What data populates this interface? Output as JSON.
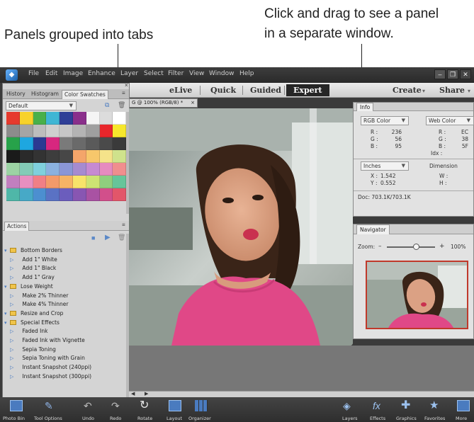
{
  "callouts": {
    "left": "Panels grouped into tabs",
    "right_line1": "Click and drag to see a panel",
    "right_line2": "in a separate window."
  },
  "menubar": {
    "items": [
      "File",
      "Edit",
      "Image",
      "Enhance",
      "Layer",
      "Select",
      "Filter",
      "View",
      "Window",
      "Help"
    ]
  },
  "modes": {
    "items": [
      "eLive",
      "Quick",
      "Guided",
      "Expert"
    ],
    "active": "Expert",
    "create": "Create",
    "share": "Share"
  },
  "left_panel": {
    "tabs": [
      "History",
      "Histogram",
      "Color Swatches"
    ],
    "active_tab": "Color Swatches",
    "swatch_set": "Default",
    "swatch_colors": [
      "#e63a2e",
      "#f7d22b",
      "#48b04a",
      "#3fb6d4",
      "#2f3f97",
      "#8a2f8b",
      "#f4f4f4",
      "#dcdcdc",
      "#ffffff",
      "#8c8c8c",
      "#a5a5a5",
      "#bdbdbd",
      "#cfcfcf",
      "#c7c7c7",
      "#b4b4b4",
      "#9f9f9f",
      "#e8262b",
      "#f7e72c",
      "#27a24a",
      "#1ea7e0",
      "#2b3a92",
      "#d7277f",
      "#7a7a7a",
      "#6a6a6a",
      "#5a5a5a",
      "#4a4a4a",
      "#3a3a3a",
      "#1a1a1a",
      "#2a2a2a",
      "#333333",
      "#3d3d3d",
      "#474747",
      "#f4a56a",
      "#f7c76b",
      "#f5e38a",
      "#cfe28c",
      "#9cd3a4",
      "#83cbb7",
      "#7fd0dd",
      "#8ab1df",
      "#8b96d6",
      "#a68bd0",
      "#c68ad1",
      "#e68bbf",
      "#f08e8e",
      "#c27fbf",
      "#e78fc0",
      "#f07f86",
      "#f39a6a",
      "#f6b365",
      "#f7e36a",
      "#cde273",
      "#8fcf7e",
      "#66c59a",
      "#4fb7a8",
      "#47a9c7",
      "#4c8fd0",
      "#5a72c4",
      "#6b5dbd",
      "#8856b2",
      "#a952a3",
      "#d24f8b",
      "#e2566a"
    ],
    "actions_tab": "Actions",
    "actions": [
      {
        "type": "folder",
        "label": "Bottom Borders"
      },
      {
        "type": "action",
        "label": "Add 1\" White"
      },
      {
        "type": "action",
        "label": "Add 1\" Black"
      },
      {
        "type": "action",
        "label": "Add 1\" Gray"
      },
      {
        "type": "folder",
        "label": "Lose Weight"
      },
      {
        "type": "action",
        "label": "Make 2% Thinner"
      },
      {
        "type": "action",
        "label": "Make 4% Thinner"
      },
      {
        "type": "folder",
        "label": "Resize and Crop"
      },
      {
        "type": "folder",
        "label": "Special Effects"
      },
      {
        "type": "action",
        "label": "Faded Ink"
      },
      {
        "type": "action",
        "label": "Faded Ink with Vignette"
      },
      {
        "type": "action",
        "label": "Sepia Toning"
      },
      {
        "type": "action",
        "label": "Sepia Toning with Grain"
      },
      {
        "type": "action",
        "label": "Instant Snapshot (240ppi)"
      },
      {
        "type": "action",
        "label": "Instant Snapshot (300ppi)"
      }
    ]
  },
  "document": {
    "tab_label": "G @ 100% (RGB/8) *"
  },
  "info_panel": {
    "tab": "Info",
    "left_mode": "RGB Color",
    "right_mode": "Web Color",
    "rgb": [
      {
        "k": "R :",
        "v": "236"
      },
      {
        "k": "G :",
        "v": "56"
      },
      {
        "k": "B :",
        "v": "95"
      }
    ],
    "web": [
      {
        "k": "R :",
        "v": "EC"
      },
      {
        "k": "G :",
        "v": "38"
      },
      {
        "k": "B :",
        "v": "5F"
      }
    ],
    "idx": "Idx :",
    "units": "Inches",
    "dimension": "Dimension",
    "x_label": "X :",
    "x_val": "1.542",
    "y_label": "Y :",
    "y_val": "0.552",
    "w_label": "W :",
    "h_label": "H :",
    "doc": "Doc: 703.1K/703.1K"
  },
  "navigator": {
    "tab": "Navigator",
    "zoom_label": "Zoom:",
    "zoom_value": "100%",
    "minus": "–",
    "plus": "+",
    "zoom_fraction": 0.6
  },
  "bottom_bar": {
    "items": [
      "Photo Bin",
      "Tool Options",
      "Undo",
      "Redo",
      "Rotate",
      "Layout",
      "Organizer"
    ],
    "right_items": [
      "Layers",
      "Effects",
      "Graphics",
      "Favorites",
      "More"
    ]
  }
}
